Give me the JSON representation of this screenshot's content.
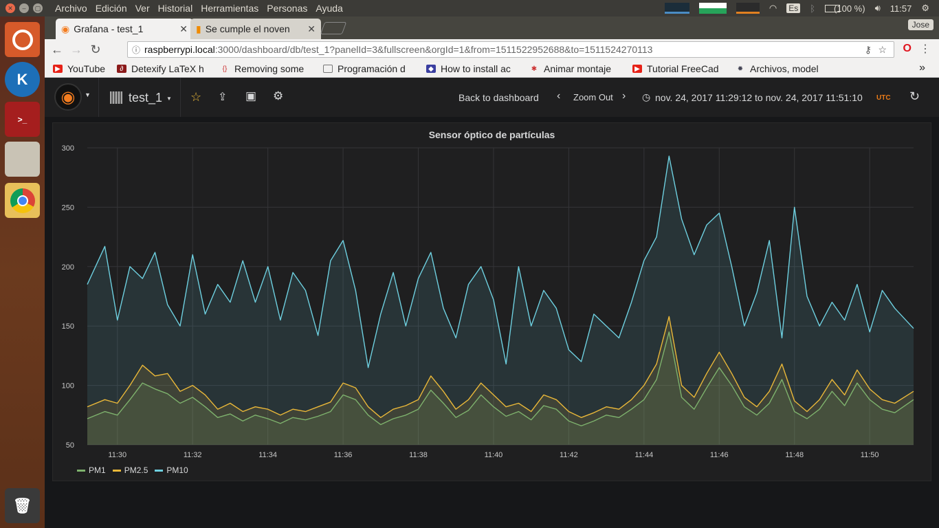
{
  "os": {
    "menu": [
      "Archivo",
      "Edición",
      "Ver",
      "Historial",
      "Herramientas",
      "Personas",
      "Ayuda"
    ],
    "keyboard": "Es",
    "battery": "(100 %)",
    "clock": "11:57"
  },
  "browser": {
    "tabs": [
      {
        "label": "Grafana - test_1",
        "active": true
      },
      {
        "label": "Se cumple el noven",
        "active": false
      }
    ],
    "user": "Jose",
    "url_host": "raspberrypi.local",
    "url_rest": ":3000/dashboard/db/test_1?panelId=3&fullscreen&orgId=1&from=1511522952688&to=1511524270113",
    "bookmarks": [
      "YouTube",
      "Detexify LaTeX h",
      "Removing some",
      "Programación d",
      "How to install ac",
      "Animar montaje",
      "Tutorial FreeCad",
      "Archivos, model"
    ],
    "bookmark_overflow": "»"
  },
  "grafana": {
    "dashboard_name": "test_1",
    "back_label": "Back to dashboard",
    "zoom_label": "Zoom Out",
    "time_range": "nov. 24, 2017 11:29:12 to nov. 24, 2017 11:51:10",
    "tz": "UTC"
  },
  "colors": {
    "pm1": "#7eb26d",
    "pm25": "#eab839",
    "pm10": "#6ed0e0"
  },
  "chart_data": {
    "type": "area",
    "title": "Sensor óptico de partículas",
    "ylim": [
      50,
      300
    ],
    "y_ticks": [
      50,
      100,
      150,
      200,
      250,
      300
    ],
    "x_tick_labels": [
      "11:30",
      "11:32",
      "11:34",
      "11:36",
      "11:38",
      "11:40",
      "11:42",
      "11:44",
      "11:46",
      "11:48",
      "11:50"
    ],
    "x": [
      "11:29:12",
      "11:29:40",
      "11:30:00",
      "11:30:20",
      "11:30:40",
      "11:31:00",
      "11:31:20",
      "11:31:40",
      "11:32:00",
      "11:32:20",
      "11:32:40",
      "11:33:00",
      "11:33:20",
      "11:33:40",
      "11:34:00",
      "11:34:20",
      "11:34:40",
      "11:35:00",
      "11:35:20",
      "11:35:40",
      "11:36:00",
      "11:36:20",
      "11:36:40",
      "11:37:00",
      "11:37:20",
      "11:37:40",
      "11:38:00",
      "11:38:20",
      "11:38:40",
      "11:39:00",
      "11:39:20",
      "11:39:40",
      "11:40:00",
      "11:40:20",
      "11:40:40",
      "11:41:00",
      "11:41:20",
      "11:41:40",
      "11:42:00",
      "11:42:20",
      "11:42:40",
      "11:43:00",
      "11:43:20",
      "11:43:40",
      "11:44:00",
      "11:44:20",
      "11:44:40",
      "11:45:00",
      "11:45:20",
      "11:45:40",
      "11:46:00",
      "11:46:20",
      "11:46:40",
      "11:47:00",
      "11:47:20",
      "11:47:40",
      "11:48:00",
      "11:48:20",
      "11:48:40",
      "11:49:00",
      "11:49:20",
      "11:49:40",
      "11:50:00",
      "11:50:20",
      "11:50:40",
      "11:51:10"
    ],
    "series": [
      {
        "name": "PM1",
        "values": [
          72,
          78,
          75,
          88,
          102,
          97,
          93,
          85,
          90,
          82,
          73,
          76,
          70,
          75,
          72,
          68,
          73,
          71,
          74,
          78,
          92,
          88,
          75,
          67,
          72,
          75,
          80,
          96,
          85,
          73,
          79,
          92,
          82,
          74,
          78,
          71,
          83,
          80,
          70,
          66,
          70,
          75,
          73,
          80,
          88,
          105,
          145,
          90,
          80,
          98,
          115,
          100,
          82,
          75,
          85,
          105,
          78,
          72,
          80,
          95,
          83,
          102,
          88,
          80,
          77,
          88
        ]
      },
      {
        "name": "PM2.5",
        "values": [
          82,
          88,
          85,
          100,
          117,
          108,
          110,
          95,
          100,
          92,
          80,
          85,
          78,
          82,
          80,
          75,
          80,
          78,
          82,
          86,
          102,
          98,
          82,
          73,
          80,
          83,
          88,
          108,
          95,
          80,
          88,
          102,
          92,
          82,
          85,
          78,
          92,
          88,
          78,
          73,
          77,
          82,
          80,
          88,
          100,
          118,
          158,
          100,
          90,
          110,
          128,
          110,
          90,
          82,
          95,
          118,
          87,
          78,
          88,
          105,
          92,
          113,
          97,
          88,
          85,
          95
        ]
      },
      {
        "name": "PM10",
        "values": [
          185,
          217,
          155,
          200,
          190,
          212,
          168,
          150,
          210,
          160,
          185,
          170,
          205,
          170,
          200,
          155,
          195,
          180,
          142,
          205,
          222,
          180,
          115,
          160,
          195,
          150,
          190,
          212,
          165,
          140,
          185,
          200,
          172,
          118,
          200,
          150,
          180,
          165,
          130,
          120,
          160,
          150,
          140,
          170,
          205,
          225,
          293,
          240,
          210,
          235,
          245,
          200,
          150,
          178,
          222,
          140,
          250,
          175,
          150,
          170,
          155,
          185,
          145,
          180,
          165,
          148
        ]
      }
    ]
  }
}
